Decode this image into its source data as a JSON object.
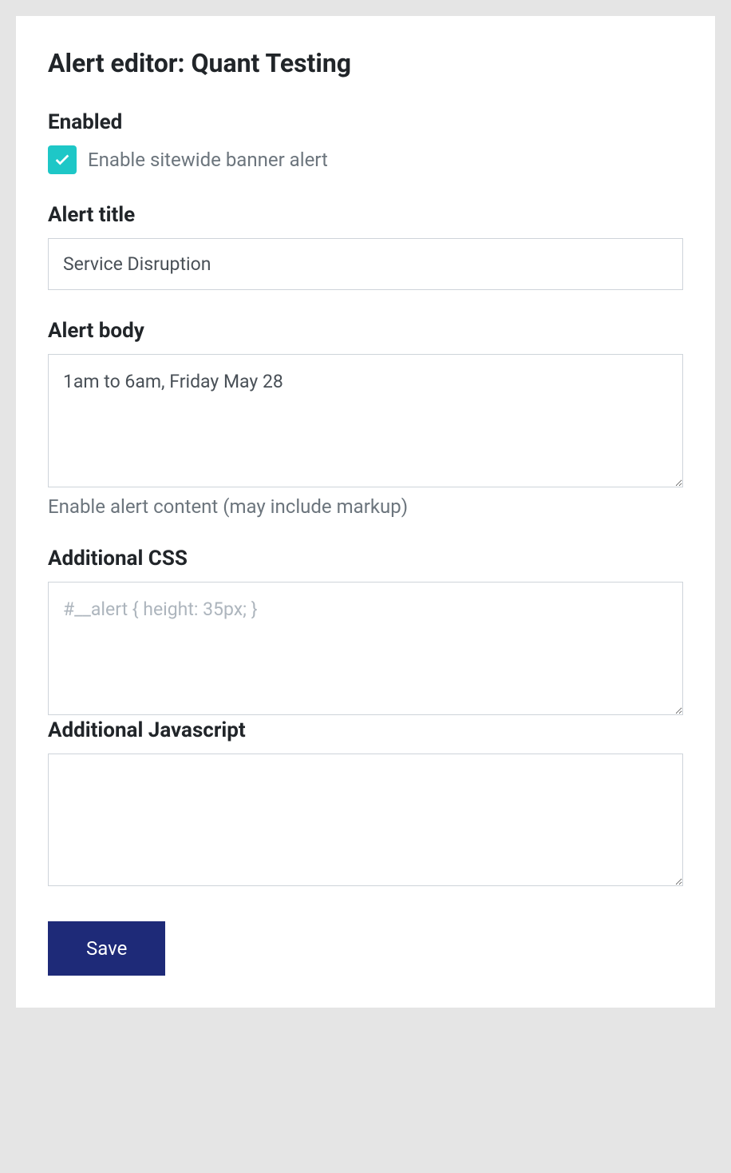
{
  "header": {
    "title": "Alert editor: Quant Testing"
  },
  "enabled": {
    "label": "Enabled",
    "checkbox_label": "Enable sitewide banner alert",
    "checked": true
  },
  "alert_title": {
    "label": "Alert title",
    "value": "Service Disruption"
  },
  "alert_body": {
    "label": "Alert body",
    "value": "1am to 6am, Friday May 28",
    "help": "Enable alert content (may include markup)"
  },
  "additional_css": {
    "label": "Additional CSS",
    "placeholder": "#__alert { height: 35px; }",
    "value": ""
  },
  "additional_js": {
    "label": "Additional Javascript",
    "value": ""
  },
  "actions": {
    "save_label": "Save"
  },
  "colors": {
    "checkbox_bg": "#1ec7c7",
    "button_bg": "#1e2a78"
  }
}
